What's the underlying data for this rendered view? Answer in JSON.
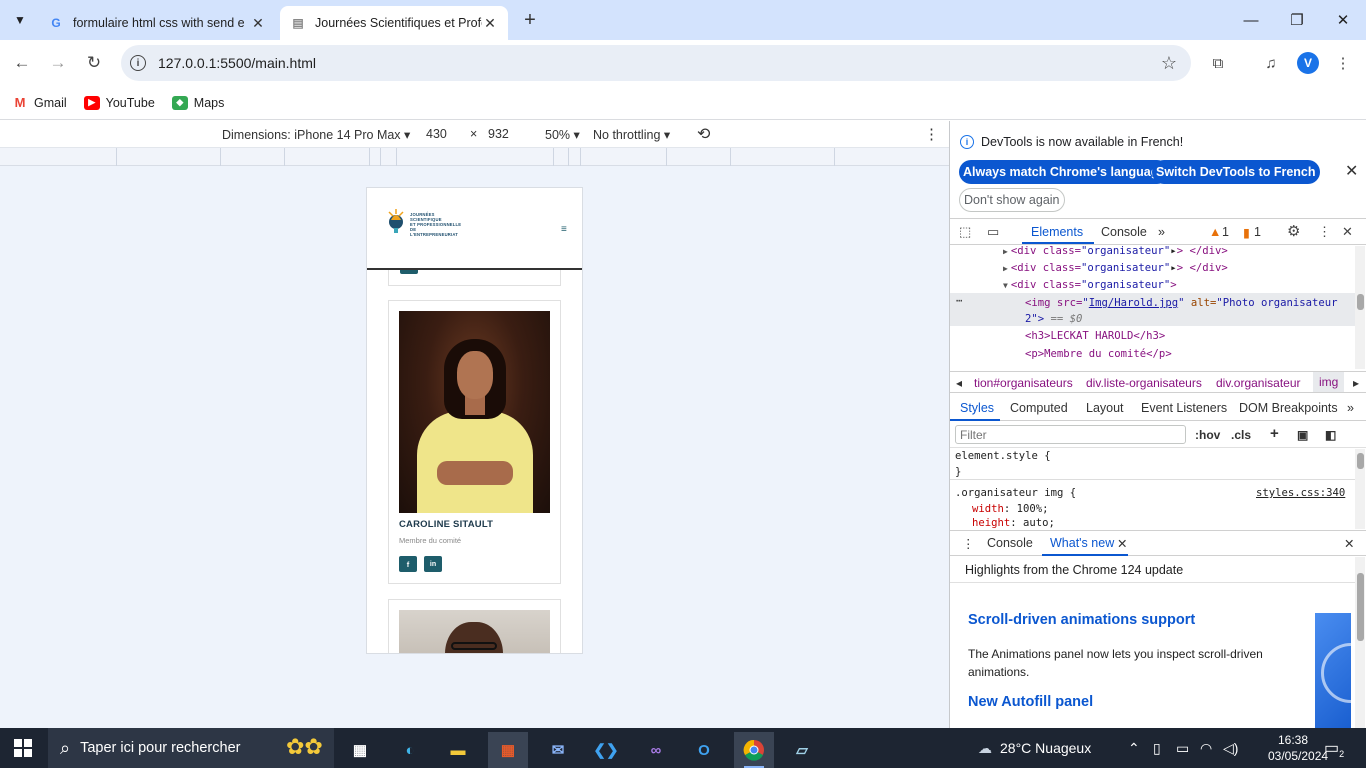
{
  "browser": {
    "tabs": [
      {
        "title": "formulaire html css with send e",
        "favicon": "google-g-icon"
      },
      {
        "title": "Journées Scientifiques et Profes",
        "favicon": "page-icon"
      }
    ],
    "url": "127.0.0.1:5500/main.html",
    "profile_initial": "V",
    "bookmarks": [
      "Gmail",
      "YouTube",
      "Maps"
    ]
  },
  "device_toolbar": {
    "dimensions_label": "Dimensions: iPhone 14 Pro Max",
    "width": "430",
    "times": "×",
    "height": "932",
    "zoom": "50%",
    "throttling": "No throttling"
  },
  "site": {
    "logo_lines": [
      "JOURNÉES",
      "SCIENTIFIQUE",
      "ET PROFESSIONNELLE",
      "DE L'ENTREPRENEURIAT"
    ],
    "menu_icon": "≡",
    "card": {
      "name": "CAROLINE SITAULT",
      "role": "Membre du comité",
      "social": [
        "f",
        "in"
      ]
    }
  },
  "devtools": {
    "infobar": {
      "message": "DevTools is now available in French!",
      "btn_match": "Always match Chrome's language",
      "btn_switch": "Switch DevTools to French",
      "btn_dont_show": "Don't show again"
    },
    "tabs": [
      "Elements",
      "Console"
    ],
    "warnings": "1",
    "errors": "1",
    "dom": {
      "line1_tag": "<div class=",
      "line1_val": "\"organisateur\"",
      "line1_end": "> </div>",
      "line3_tag": "<div class=",
      "line3_val": "\"organisateur\"",
      "line3_end": ">",
      "img_open": "<img src=",
      "img_src": "Img/Harold.jpg",
      "img_alt_attr": " alt=",
      "img_alt_val": "\"Photo organisateur",
      "img_alt_cont": "2\">",
      "eq": " == $0",
      "h3": "<h3>LECKAT HAROLD</h3>",
      "p": "<p>Membre du comité</p>"
    },
    "breadcrumbs": [
      "tion#organisateurs",
      "div.liste-organisateurs",
      "div.organisateur",
      "img"
    ],
    "styles_tabs": [
      "Styles",
      "Computed",
      "Layout",
      "Event Listeners",
      "DOM Breakpoints"
    ],
    "filter_placeholder": "Filter",
    "hov": ":hov",
    "cls": ".cls",
    "rules": {
      "element_style": "element.style {",
      "close": "}",
      "selector": ".organisateur img {",
      "source": "styles.css:340",
      "prop1": "width",
      "val1": " 100%;",
      "prop2": "height",
      "val2": " auto;"
    },
    "drawer_tabs": [
      "Console",
      "What's new"
    ],
    "whats_new": {
      "header": "Highlights from the Chrome 124 update",
      "h1": "Scroll-driven animations support",
      "p": "The Animations panel now lets you inspect scroll-driven animations.",
      "h2": "New Autofill panel"
    }
  },
  "taskbar": {
    "search_placeholder": "Taper ici pour rechercher",
    "weather": "28°C  Nuageux",
    "time": "16:38",
    "date": "03/05/2024",
    "notifications": "2"
  },
  "colors": {
    "accent": "#0b57d0",
    "site_primary": "#1e5d6b",
    "tabbar": "#d3e3fd",
    "taskbar": "#1d2532"
  }
}
